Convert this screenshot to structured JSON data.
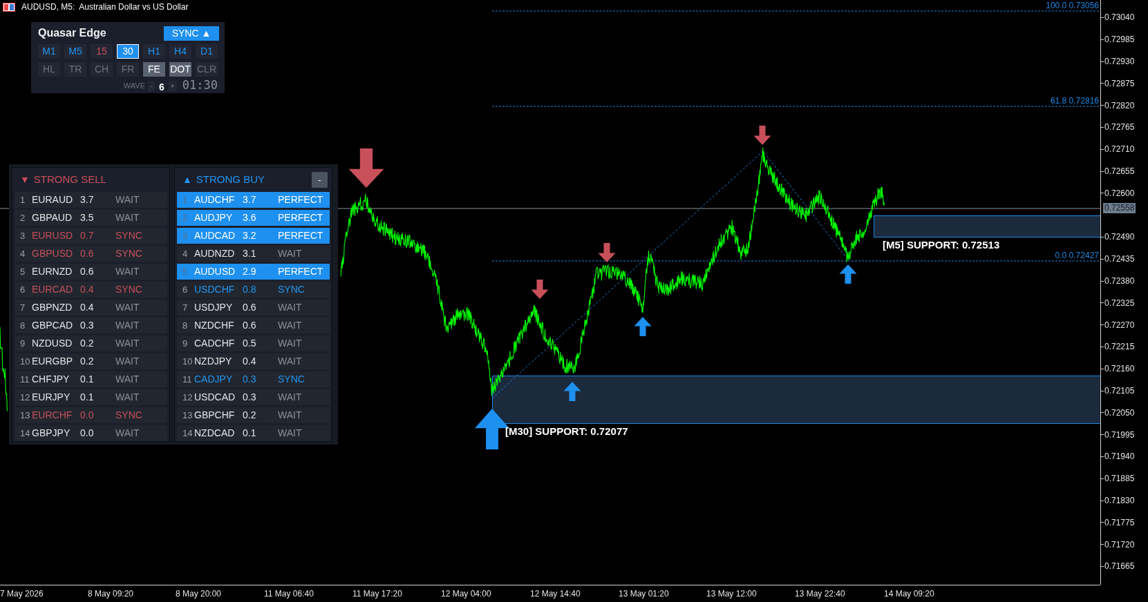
{
  "window": {
    "title": "AUDUSD, M5:  Australian Dollar vs US Dollar"
  },
  "control_panel": {
    "title": "Quasar Edge",
    "sync_button": "SYNC ▲",
    "timeframes": [
      {
        "label": "M1",
        "selected": false,
        "color": "#2196f3"
      },
      {
        "label": "M5",
        "selected": false,
        "color": "#2196f3"
      },
      {
        "label": "15",
        "selected": false,
        "color": "#c8505a"
      },
      {
        "label": "30",
        "selected": true,
        "color": "#ffffff"
      },
      {
        "label": "H1",
        "selected": false,
        "color": "#2196f3"
      },
      {
        "label": "H4",
        "selected": false,
        "color": "#2196f3"
      },
      {
        "label": "D1",
        "selected": false,
        "color": "#2196f3"
      }
    ],
    "tools": [
      {
        "label": "HL",
        "on": false
      },
      {
        "label": "TR",
        "on": false
      },
      {
        "label": "CH",
        "on": false
      },
      {
        "label": "FR",
        "on": false
      },
      {
        "label": "FE",
        "on": true
      },
      {
        "label": "DOT",
        "on": true
      },
      {
        "label": "CLR",
        "on": false
      }
    ],
    "wave": {
      "label": "WAVE",
      "minus": "-",
      "value": "6",
      "plus": "+"
    },
    "timer": "01:30"
  },
  "sell_list": {
    "icon": "▼",
    "title": "STRONG SELL",
    "rows": [
      {
        "rank": "1",
        "pair": "EURAUD",
        "score": "3.7",
        "status": "WAIT",
        "kind": "wait"
      },
      {
        "rank": "2",
        "pair": "GBPAUD",
        "score": "3.5",
        "status": "WAIT",
        "kind": "wait"
      },
      {
        "rank": "3",
        "pair": "EURUSD",
        "score": "0.7",
        "status": "SYNC",
        "kind": "sync"
      },
      {
        "rank": "4",
        "pair": "GBPUSD",
        "score": "0.6",
        "status": "SYNC",
        "kind": "sync"
      },
      {
        "rank": "5",
        "pair": "EURNZD",
        "score": "0.6",
        "status": "WAIT",
        "kind": "wait"
      },
      {
        "rank": "6",
        "pair": "EURCAD",
        "score": "0.4",
        "status": "SYNC",
        "kind": "sync"
      },
      {
        "rank": "7",
        "pair": "GBPNZD",
        "score": "0.4",
        "status": "WAIT",
        "kind": "wait"
      },
      {
        "rank": "8",
        "pair": "GBPCAD",
        "score": "0.3",
        "status": "WAIT",
        "kind": "wait"
      },
      {
        "rank": "9",
        "pair": "NZDUSD",
        "score": "0.2",
        "status": "WAIT",
        "kind": "wait"
      },
      {
        "rank": "10",
        "pair": "EURGBP",
        "score": "0.2",
        "status": "WAIT",
        "kind": "wait"
      },
      {
        "rank": "11",
        "pair": "CHFJPY",
        "score": "0.1",
        "status": "WAIT",
        "kind": "wait"
      },
      {
        "rank": "12",
        "pair": "EURJPY",
        "score": "0.1",
        "status": "WAIT",
        "kind": "wait"
      },
      {
        "rank": "13",
        "pair": "EURCHF",
        "score": "0.0",
        "status": "SYNC",
        "kind": "sync"
      },
      {
        "rank": "14",
        "pair": "GBPJPY",
        "score": "0.0",
        "status": "WAIT",
        "kind": "wait"
      }
    ]
  },
  "buy_list": {
    "icon": "▲",
    "title": "STRONG BUY",
    "collapse_button": "-",
    "rows": [
      {
        "rank": "1",
        "pair": "AUDCHF",
        "score": "3.7",
        "status": "PERFECT",
        "kind": "perfect"
      },
      {
        "rank": "2",
        "pair": "AUDJPY",
        "score": "3.6",
        "status": "PERFECT",
        "kind": "perfect"
      },
      {
        "rank": "3",
        "pair": "AUDCAD",
        "score": "3.2",
        "status": "PERFECT",
        "kind": "perfect"
      },
      {
        "rank": "4",
        "pair": "AUDNZD",
        "score": "3.1",
        "status": "WAIT",
        "kind": "wait"
      },
      {
        "rank": "5",
        "pair": "AUDUSD",
        "score": "2.9",
        "status": "PERFECT",
        "kind": "perfect"
      },
      {
        "rank": "6",
        "pair": "USDCHF",
        "score": "0.8",
        "status": "SYNC",
        "kind": "sync"
      },
      {
        "rank": "7",
        "pair": "USDJPY",
        "score": "0.6",
        "status": "WAIT",
        "kind": "wait"
      },
      {
        "rank": "8",
        "pair": "NZDCHF",
        "score": "0.6",
        "status": "WAIT",
        "kind": "wait"
      },
      {
        "rank": "9",
        "pair": "CADCHF",
        "score": "0.5",
        "status": "WAIT",
        "kind": "wait"
      },
      {
        "rank": "10",
        "pair": "NZDJPY",
        "score": "0.4",
        "status": "WAIT",
        "kind": "wait"
      },
      {
        "rank": "11",
        "pair": "CADJPY",
        "score": "0.3",
        "status": "SYNC",
        "kind": "sync"
      },
      {
        "rank": "12",
        "pair": "USDCAD",
        "score": "0.3",
        "status": "WAIT",
        "kind": "wait"
      },
      {
        "rank": "13",
        "pair": "GBPCHF",
        "score": "0.2",
        "status": "WAIT",
        "kind": "wait"
      },
      {
        "rank": "14",
        "pair": "NZDCAD",
        "score": "0.1",
        "status": "WAIT",
        "kind": "wait"
      }
    ]
  },
  "chart": {
    "fib_levels": [
      "100.0 0.73056",
      "61.8 0.72816",
      "0.0 0.72427"
    ],
    "support_zones": [
      "[M30] SUPPORT: 0.72077",
      "[M5] SUPPORT: 0.72513"
    ],
    "current_price": "0.72558",
    "price_axis": [
      "0.73040",
      "0.72985",
      "0.72930",
      "0.72875",
      "0.72820",
      "0.72765",
      "0.72710",
      "0.72655",
      "0.72600",
      "0.72490",
      "0.72435",
      "0.72380",
      "0.72325",
      "0.72270",
      "0.72215",
      "0.72160",
      "0.72105",
      "0.72050",
      "0.71995",
      "0.71940",
      "0.71885",
      "0.71830",
      "0.71775",
      "0.71720",
      "0.71665"
    ],
    "time_axis": [
      "7 May 2026",
      "8 May 09:20",
      "8 May 20:00",
      "11 May 06:40",
      "11 May 17:20",
      "12 May 04:00",
      "12 May 14:40",
      "13 May 01:20",
      "13 May 12:00",
      "13 May 22:40",
      "14 May 09:20"
    ]
  }
}
